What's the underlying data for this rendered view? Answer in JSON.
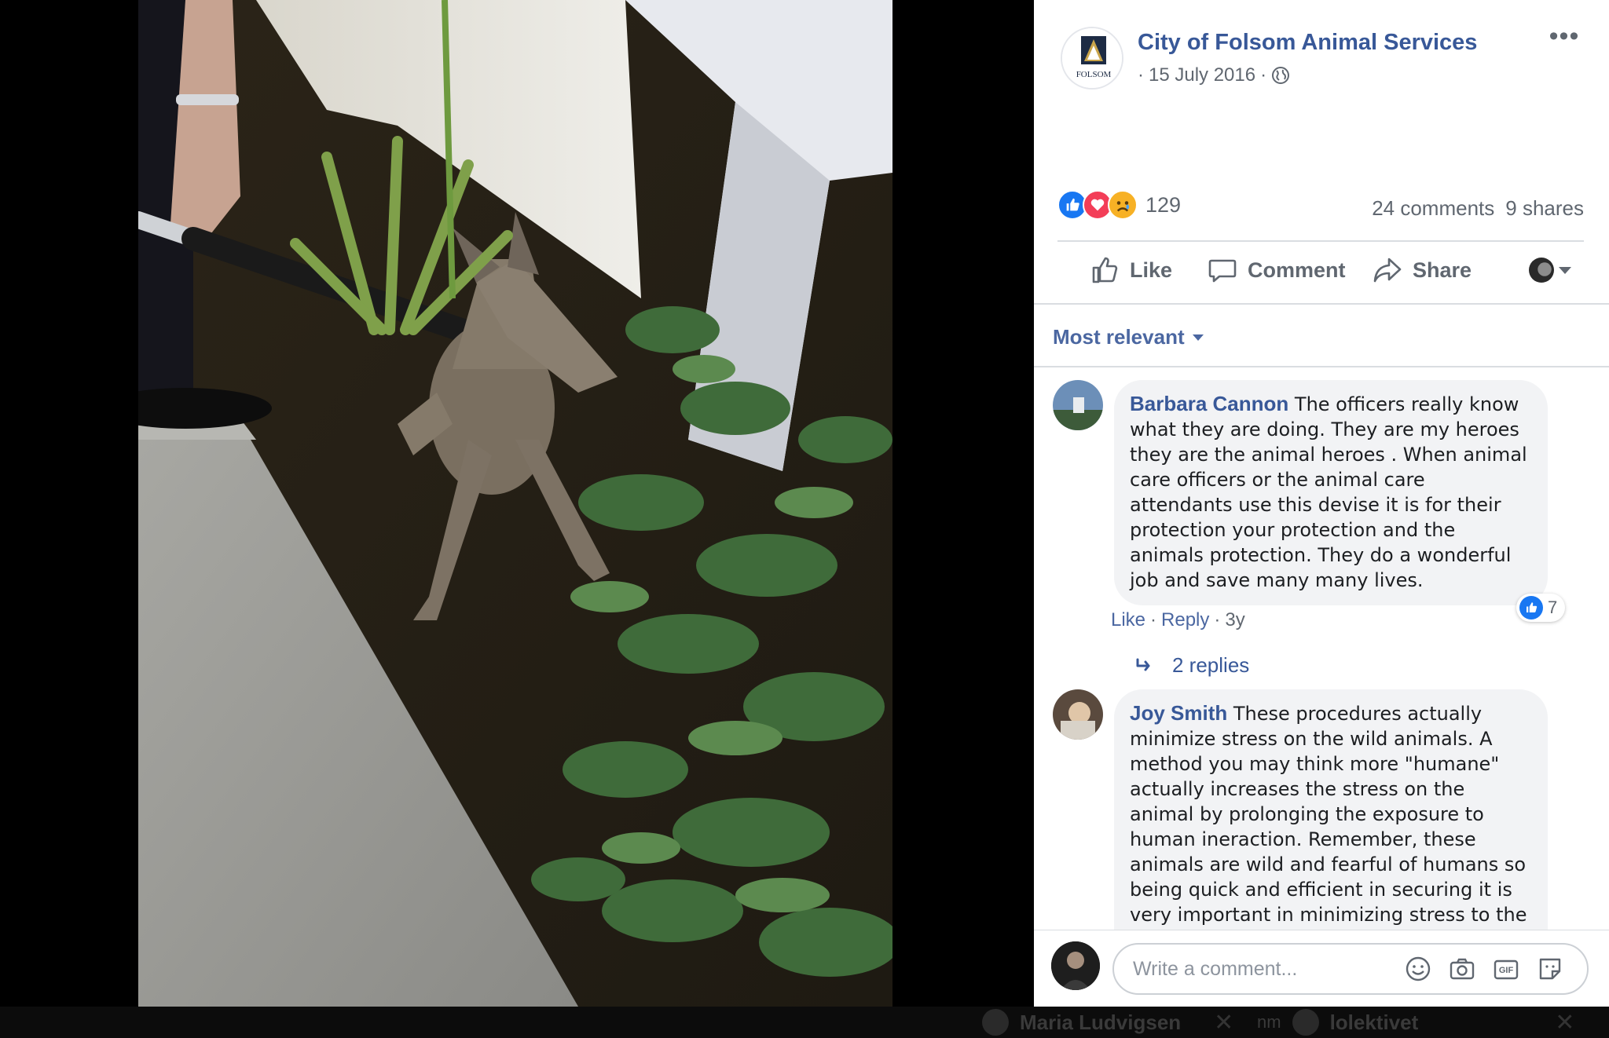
{
  "post": {
    "page_name": "City of Folsom Animal Services",
    "avatar_text": "FOLSOM",
    "date_prefix": "·",
    "date": "15 July 2016",
    "date_suffix": "·",
    "reaction_count": "129",
    "comments_count": "24 comments",
    "shares_count": "9 shares",
    "more_label": "•••"
  },
  "actions": {
    "like": "Like",
    "comment": "Comment",
    "share": "Share"
  },
  "filter": {
    "label": "Most relevant"
  },
  "comments": [
    {
      "author": "Barbara Cannon",
      "text": "The officers really know what they are doing. They are my heroes they are the animal heroes . When animal care officers or the animal care attendants use this devise it is for their protection your protection and the animals protection. They do a wonderful job and save many many lives.",
      "like": "Like",
      "sep1": "·",
      "reply": "Reply",
      "sep2": "·",
      "age": "3y",
      "likes": "7",
      "replies": "2 replies"
    },
    {
      "author": "Joy Smith",
      "text": "These procedures actually minimize stress on the wild animals. A method you may think more \"humane\" actually increases the stress on the animal by prolonging the exposure to human ineraction. Remember, these animals are wild and fearful of humans so being quick and efficient in securing it is very important in minimizing stress to the"
    }
  ],
  "composer": {
    "placeholder": "Write a comment...",
    "gif_label": "GIF"
  },
  "chat": {
    "tab1": "Maria Ludvigsen",
    "tab2": "lolektivet",
    "tab2_prefix": "nm",
    "close": "✕"
  },
  "colors": {
    "link": "#385898",
    "like_blue": "#1877f2",
    "love_red": "#f33e58",
    "sad_yellow": "#f7b125",
    "bubble": "#f2f3f5"
  }
}
